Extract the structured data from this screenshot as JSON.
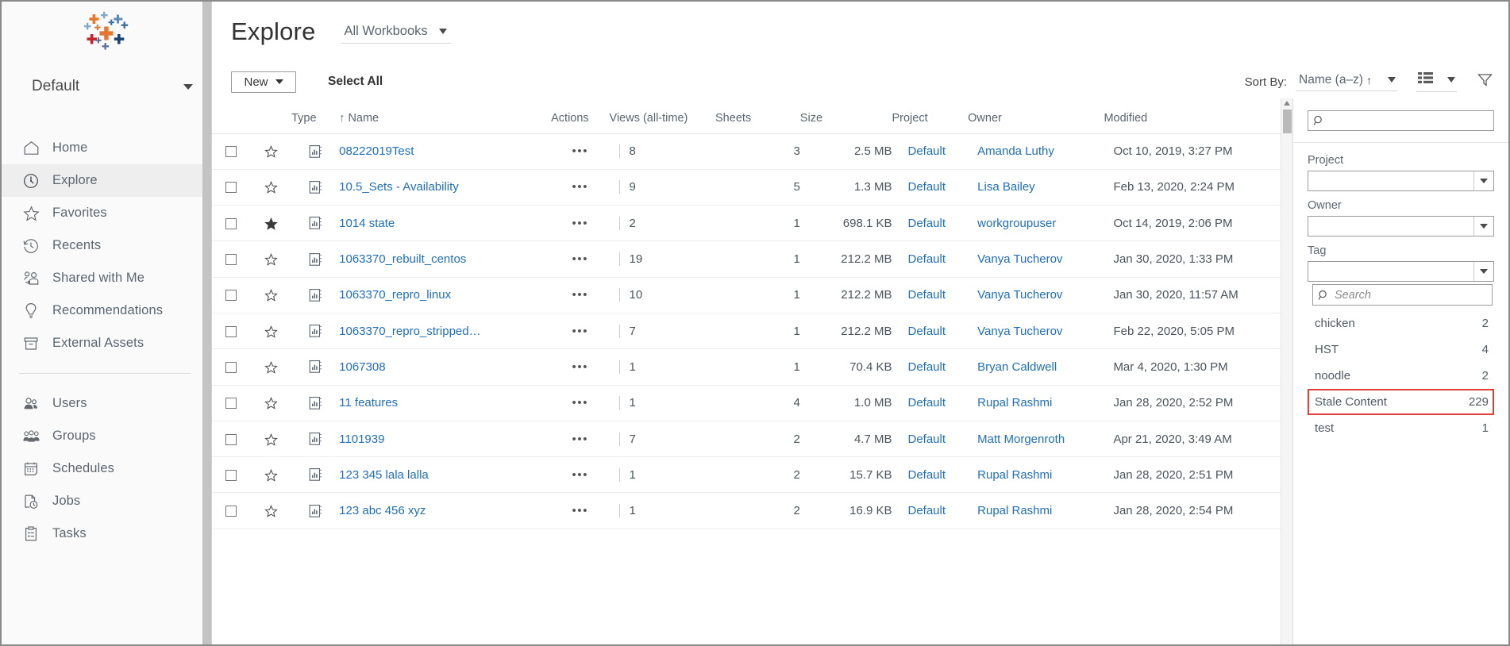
{
  "sidebar": {
    "site_name": "Default",
    "logo_name": "tableau-logo",
    "items": [
      {
        "label": "Home",
        "icon": "home-icon",
        "active": false
      },
      {
        "label": "Explore",
        "icon": "explore-icon",
        "active": true
      },
      {
        "label": "Favorites",
        "icon": "star-icon",
        "active": false
      },
      {
        "label": "Recents",
        "icon": "clock-icon",
        "active": false
      },
      {
        "label": "Shared with Me",
        "icon": "shared-icon",
        "active": false
      },
      {
        "label": "Recommendations",
        "icon": "lightbulb-icon",
        "active": false
      },
      {
        "label": "External Assets",
        "icon": "archive-box-icon",
        "active": false
      }
    ],
    "admin_items": [
      {
        "label": "Users",
        "icon": "users-icon"
      },
      {
        "label": "Groups",
        "icon": "groups-icon"
      },
      {
        "label": "Schedules",
        "icon": "calendar-icon"
      },
      {
        "label": "Jobs",
        "icon": "jobs-icon"
      },
      {
        "label": "Tasks",
        "icon": "tasks-icon"
      }
    ]
  },
  "header": {
    "title": "Explore",
    "content_type_selected": "All Workbooks"
  },
  "toolbar": {
    "new_label": "New",
    "select_all_label": "Select All",
    "sort_by_label": "Sort By:",
    "sort_value": "Name (a–z)",
    "sort_direction_glyph": "↑",
    "view_icon": "list-view-icon",
    "filter_icon": "filter-icon"
  },
  "table": {
    "columns": [
      "Type",
      "Name",
      "Actions",
      "Views (all-time)",
      "Sheets",
      "Size",
      "Project",
      "Owner",
      "Modified"
    ],
    "sort_indicator": "↑",
    "rows": [
      {
        "starred": false,
        "type_icon": "workbook-icon",
        "name": "08222019Test",
        "views": "8",
        "sheets": "3",
        "size": "2.5 MB",
        "project": "Default",
        "owner": "Amanda Luthy",
        "modified": "Oct 10, 2019, 3:27 PM"
      },
      {
        "starred": false,
        "type_icon": "workbook-icon",
        "name": "10.5_Sets - Availability",
        "views": "9",
        "sheets": "5",
        "size": "1.3 MB",
        "project": "Default",
        "owner": "Lisa Bailey",
        "modified": "Feb 13, 2020, 2:24 PM"
      },
      {
        "starred": true,
        "type_icon": "workbook-icon",
        "name": "1014 state",
        "views": "2",
        "sheets": "1",
        "size": "698.1 KB",
        "project": "Default",
        "owner": "workgroupuser",
        "modified": "Oct 14, 2019, 2:06 PM"
      },
      {
        "starred": false,
        "type_icon": "workbook-icon",
        "name": "1063370_rebuilt_centos",
        "views": "19",
        "sheets": "1",
        "size": "212.2 MB",
        "project": "Default",
        "owner": "Vanya Tucherov",
        "modified": "Jan 30, 2020, 1:33 PM"
      },
      {
        "starred": false,
        "type_icon": "workbook-icon",
        "name": "1063370_repro_linux",
        "views": "10",
        "sheets": "1",
        "size": "212.2 MB",
        "project": "Default",
        "owner": "Vanya Tucherov",
        "modified": "Jan 30, 2020, 11:57 AM"
      },
      {
        "starred": false,
        "type_icon": "workbook-icon",
        "name": "1063370_repro_stripped…",
        "views": "7",
        "sheets": "1",
        "size": "212.2 MB",
        "project": "Default",
        "owner": "Vanya Tucherov",
        "modified": "Feb 22, 2020, 5:05 PM"
      },
      {
        "starred": false,
        "type_icon": "workbook-icon",
        "name": "1067308",
        "views": "1",
        "sheets": "1",
        "size": "70.4 KB",
        "project": "Default",
        "owner": "Bryan Caldwell",
        "modified": "Mar 4, 2020, 1:30 PM"
      },
      {
        "starred": false,
        "type_icon": "workbook-icon",
        "name": "11 features",
        "views": "1",
        "sheets": "4",
        "size": "1.0 MB",
        "project": "Default",
        "owner": "Rupal Rashmi",
        "modified": "Jan 28, 2020, 2:52 PM"
      },
      {
        "starred": false,
        "type_icon": "workbook-icon",
        "name": "1101939",
        "views": "7",
        "sheets": "2",
        "size": "4.7 MB",
        "project": "Default",
        "owner": "Matt Morgenroth",
        "modified": "Apr 21, 2020, 3:49 AM"
      },
      {
        "starred": false,
        "type_icon": "workbook-icon",
        "name": "123 345 lala lalla",
        "views": "1",
        "sheets": "2",
        "size": "15.7 KB",
        "project": "Default",
        "owner": "Rupal Rashmi",
        "modified": "Jan 28, 2020, 2:51 PM"
      },
      {
        "starred": false,
        "type_icon": "workbook-icon",
        "name": "123 abc 456 xyz",
        "views": "1",
        "sheets": "2",
        "size": "16.9 KB",
        "project": "Default",
        "owner": "Rupal Rashmi",
        "modified": "Jan 28, 2020, 2:54 PM"
      }
    ]
  },
  "filter_panel": {
    "search_value": "",
    "search_placeholder": "",
    "project_label": "Project",
    "project_value": "",
    "owner_label": "Owner",
    "owner_value": "",
    "tag_label": "Tag",
    "tag_value": "",
    "tag_search_placeholder": "Search",
    "tag_search_value": "",
    "highlight_color": "#e13f35",
    "tags": [
      {
        "name": "chicken",
        "count": "2",
        "highlighted": false
      },
      {
        "name": "HST",
        "count": "4",
        "highlighted": false
      },
      {
        "name": "noodle",
        "count": "2",
        "highlighted": false
      },
      {
        "name": "Stale Content",
        "count": "229",
        "highlighted": true
      },
      {
        "name": "test",
        "count": "1",
        "highlighted": false
      }
    ]
  }
}
